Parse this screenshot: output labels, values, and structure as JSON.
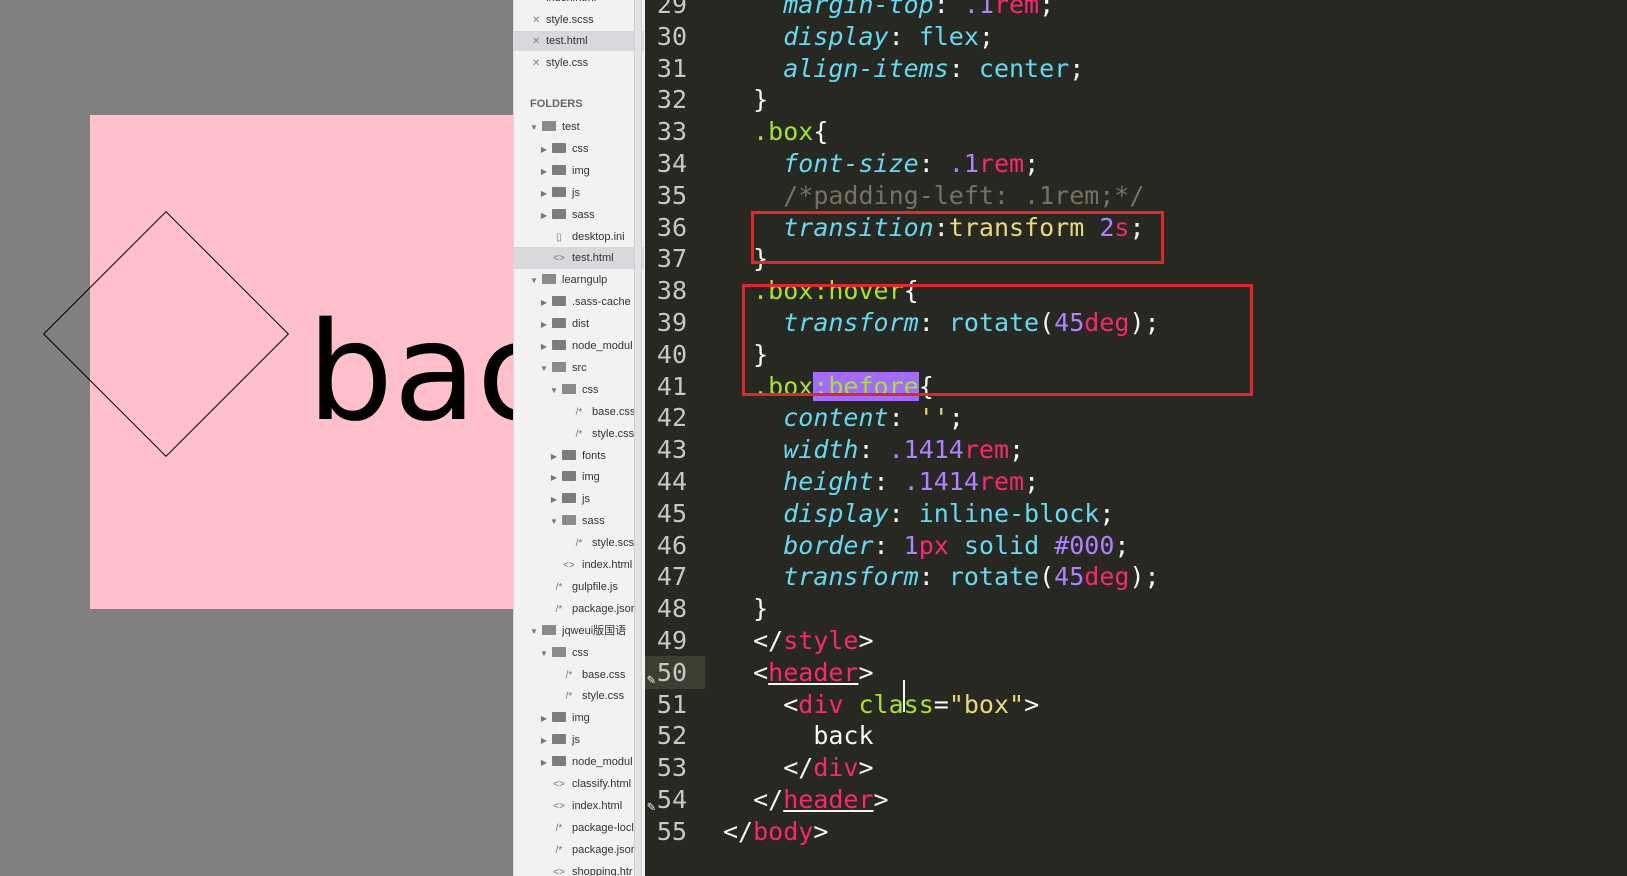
{
  "preview": {
    "text": "bac"
  },
  "open_files": [
    {
      "name": "index.html",
      "active": false
    },
    {
      "name": "style.scss",
      "active": false
    },
    {
      "name": "test.html",
      "active": true
    },
    {
      "name": "style.css",
      "active": false
    }
  ],
  "sidebar": {
    "folders_title": "FOLDERS",
    "tree": [
      {
        "label": "test",
        "depth": 0,
        "type": "folder",
        "open": true
      },
      {
        "label": "css",
        "depth": 1,
        "type": "folder",
        "open": false
      },
      {
        "label": "img",
        "depth": 1,
        "type": "folder",
        "open": false
      },
      {
        "label": "js",
        "depth": 1,
        "type": "folder",
        "open": false
      },
      {
        "label": "sass",
        "depth": 1,
        "type": "folder",
        "open": false
      },
      {
        "label": "desktop.ini",
        "depth": 1,
        "type": "file",
        "icon": "file-icon"
      },
      {
        "label": "test.html",
        "depth": 1,
        "type": "file",
        "icon": "html-icon",
        "active": true
      },
      {
        "label": "learngulp",
        "depth": 0,
        "type": "folder",
        "open": true
      },
      {
        "label": ".sass-cache",
        "depth": 1,
        "type": "folder",
        "open": false
      },
      {
        "label": "dist",
        "depth": 1,
        "type": "folder",
        "open": false
      },
      {
        "label": "node_modul",
        "depth": 1,
        "type": "folder",
        "open": false
      },
      {
        "label": "src",
        "depth": 1,
        "type": "folder",
        "open": true
      },
      {
        "label": "css",
        "depth": 2,
        "type": "folder",
        "open": true
      },
      {
        "label": "base.css",
        "depth": 3,
        "type": "file",
        "icon": "comment-file-icon"
      },
      {
        "label": "style.css",
        "depth": 3,
        "type": "file",
        "icon": "comment-file-icon"
      },
      {
        "label": "fonts",
        "depth": 2,
        "type": "folder",
        "open": false
      },
      {
        "label": "img",
        "depth": 2,
        "type": "folder",
        "open": false
      },
      {
        "label": "js",
        "depth": 2,
        "type": "folder",
        "open": false
      },
      {
        "label": "sass",
        "depth": 2,
        "type": "folder",
        "open": true
      },
      {
        "label": "style.scss",
        "depth": 3,
        "type": "file",
        "icon": "comment-file-icon"
      },
      {
        "label": "index.html",
        "depth": 2,
        "type": "file",
        "icon": "html-icon"
      },
      {
        "label": "gulpfile.js",
        "depth": 1,
        "type": "file",
        "icon": "comment-file-icon"
      },
      {
        "label": "package.jsor",
        "depth": 1,
        "type": "file",
        "icon": "comment-file-icon"
      },
      {
        "label": "jqweui版国语",
        "depth": 0,
        "type": "folder",
        "open": true
      },
      {
        "label": "css",
        "depth": 1,
        "type": "folder",
        "open": true
      },
      {
        "label": "base.css",
        "depth": 2,
        "type": "file",
        "icon": "comment-file-icon"
      },
      {
        "label": "style.css",
        "depth": 2,
        "type": "file",
        "icon": "comment-file-icon"
      },
      {
        "label": "img",
        "depth": 1,
        "type": "folder",
        "open": false
      },
      {
        "label": "js",
        "depth": 1,
        "type": "folder",
        "open": false
      },
      {
        "label": "node_modul",
        "depth": 1,
        "type": "folder",
        "open": false
      },
      {
        "label": "classify.html",
        "depth": 1,
        "type": "file",
        "icon": "html-icon"
      },
      {
        "label": "index.html",
        "depth": 1,
        "type": "file",
        "icon": "html-icon"
      },
      {
        "label": "package-locl",
        "depth": 1,
        "type": "file",
        "icon": "comment-file-icon"
      },
      {
        "label": "package.jsor",
        "depth": 1,
        "type": "file",
        "icon": "comment-file-icon"
      },
      {
        "label": "shopping.htr",
        "depth": 1,
        "type": "file",
        "icon": "html-icon"
      }
    ]
  },
  "editor": {
    "current_line": 50,
    "lines": [
      {
        "n": "29",
        "marker": false,
        "tokens": [
          [
            "  ",
            "t"
          ],
          [
            "margin-top",
            "prop"
          ],
          [
            ": ",
            "t"
          ],
          [
            ".1",
            "num"
          ],
          [
            "rem",
            "unit"
          ],
          [
            ";",
            "t"
          ]
        ]
      },
      {
        "n": "30",
        "marker": false,
        "tokens": [
          [
            "  ",
            "t"
          ],
          [
            "display",
            "prop"
          ],
          [
            ": ",
            "t"
          ],
          [
            "flex",
            "val"
          ],
          [
            ";",
            "t"
          ]
        ]
      },
      {
        "n": "31",
        "marker": false,
        "tokens": [
          [
            "  ",
            "t"
          ],
          [
            "align-items",
            "prop"
          ],
          [
            ": ",
            "t"
          ],
          [
            "center",
            "val"
          ],
          [
            ";",
            "t"
          ]
        ]
      },
      {
        "n": "32",
        "marker": false,
        "tokens": [
          [
            "}",
            "t"
          ]
        ]
      },
      {
        "n": "33",
        "marker": false,
        "tokens": [
          [
            ".box",
            "sel"
          ],
          [
            "{",
            "t"
          ]
        ]
      },
      {
        "n": "34",
        "marker": false,
        "tokens": [
          [
            "  ",
            "t"
          ],
          [
            "font-size",
            "prop"
          ],
          [
            ": ",
            "t"
          ],
          [
            ".1",
            "num"
          ],
          [
            "rem",
            "unit"
          ],
          [
            ";",
            "t"
          ]
        ]
      },
      {
        "n": "35",
        "marker": false,
        "tokens": [
          [
            "  ",
            "t"
          ],
          [
            "/*padding-left: .1rem;*/",
            "cmt"
          ]
        ]
      },
      {
        "n": "36",
        "marker": false,
        "tokens": [
          [
            "  ",
            "t"
          ],
          [
            "transition",
            "prop"
          ],
          [
            ":",
            "t"
          ],
          [
            "transform ",
            "tval"
          ],
          [
            "2",
            "num"
          ],
          [
            "s",
            "unit"
          ],
          [
            ";",
            "t"
          ]
        ]
      },
      {
        "n": "37",
        "marker": false,
        "tokens": [
          [
            "}",
            "t"
          ]
        ]
      },
      {
        "n": "38",
        "marker": false,
        "tokens": [
          [
            ".box:hover",
            "sel"
          ],
          [
            "{",
            "t"
          ]
        ]
      },
      {
        "n": "39",
        "marker": false,
        "tokens": [
          [
            "  ",
            "t"
          ],
          [
            "transform",
            "prop"
          ],
          [
            ": ",
            "t"
          ],
          [
            "rotate",
            "fn"
          ],
          [
            "(",
            "t"
          ],
          [
            "45",
            "num"
          ],
          [
            "deg",
            "unit"
          ],
          [
            ");",
            "t"
          ]
        ]
      },
      {
        "n": "40",
        "marker": false,
        "tokens": [
          [
            "}",
            "t"
          ]
        ]
      },
      {
        "n": "41",
        "marker": false,
        "tokens": [
          [
            ".box",
            "sel"
          ],
          [
            ":before",
            "hl"
          ],
          [
            "{",
            "t"
          ]
        ]
      },
      {
        "n": "42",
        "marker": false,
        "tokens": [
          [
            "  ",
            "t"
          ],
          [
            "content",
            "prop"
          ],
          [
            ": ",
            "t"
          ],
          [
            "''",
            "str"
          ],
          [
            ";",
            "t"
          ]
        ]
      },
      {
        "n": "43",
        "marker": false,
        "tokens": [
          [
            "  ",
            "t"
          ],
          [
            "width",
            "prop"
          ],
          [
            ": ",
            "t"
          ],
          [
            ".1414",
            "num"
          ],
          [
            "rem",
            "unit"
          ],
          [
            ";",
            "t"
          ]
        ]
      },
      {
        "n": "44",
        "marker": false,
        "tokens": [
          [
            "  ",
            "t"
          ],
          [
            "height",
            "prop"
          ],
          [
            ": ",
            "t"
          ],
          [
            ".1414",
            "num"
          ],
          [
            "rem",
            "unit"
          ],
          [
            ";",
            "t"
          ]
        ]
      },
      {
        "n": "45",
        "marker": false,
        "tokens": [
          [
            "  ",
            "t"
          ],
          [
            "display",
            "prop"
          ],
          [
            ": ",
            "t"
          ],
          [
            "inline-block",
            "val"
          ],
          [
            ";",
            "t"
          ]
        ]
      },
      {
        "n": "46",
        "marker": false,
        "tokens": [
          [
            "  ",
            "t"
          ],
          [
            "border",
            "prop"
          ],
          [
            ": ",
            "t"
          ],
          [
            "1",
            "num"
          ],
          [
            "px",
            "unit"
          ],
          [
            " ",
            "t"
          ],
          [
            "solid",
            "val"
          ],
          [
            " ",
            "t"
          ],
          [
            "#000",
            "num"
          ],
          [
            ";",
            "t"
          ]
        ]
      },
      {
        "n": "47",
        "marker": false,
        "tokens": [
          [
            "  ",
            "t"
          ],
          [
            "transform",
            "prop"
          ],
          [
            ": ",
            "t"
          ],
          [
            "rotate",
            "fn"
          ],
          [
            "(",
            "t"
          ],
          [
            "45",
            "num"
          ],
          [
            "deg",
            "unit"
          ],
          [
            ");",
            "t"
          ]
        ]
      },
      {
        "n": "48",
        "marker": false,
        "tokens": [
          [
            "}",
            "t"
          ]
        ]
      },
      {
        "n": "49",
        "marker": false,
        "tokens": [
          [
            "</",
            "t"
          ],
          [
            "style",
            "tagp"
          ],
          [
            ">",
            "t"
          ]
        ]
      },
      {
        "n": "50",
        "marker": true,
        "tokens": [
          [
            "<",
            "t"
          ],
          [
            "header",
            "tag"
          ],
          [
            ">",
            "t"
          ]
        ]
      },
      {
        "n": "51",
        "marker": false,
        "tokens": [
          [
            "  <",
            "t"
          ],
          [
            "div",
            "tagp"
          ],
          [
            " ",
            "t"
          ],
          [
            "class",
            "attr"
          ],
          [
            "=",
            "t"
          ],
          [
            "\"box\"",
            "str"
          ],
          [
            ">",
            "t"
          ]
        ]
      },
      {
        "n": "52",
        "marker": false,
        "tokens": [
          [
            "    back",
            "t"
          ]
        ]
      },
      {
        "n": "53",
        "marker": false,
        "tokens": [
          [
            "  </",
            "t"
          ],
          [
            "div",
            "tagp"
          ],
          [
            ">",
            "t"
          ]
        ]
      },
      {
        "n": "54",
        "marker": true,
        "tokens": [
          [
            "</",
            "t"
          ],
          [
            "header",
            "tag"
          ],
          [
            ">",
            "t"
          ]
        ]
      },
      {
        "n": "55",
        "marker": false,
        "tokens": [
          [
            "</",
            "t"
          ],
          [
            "body",
            "tagp"
          ],
          [
            ">",
            "t"
          ]
        ]
      }
    ]
  }
}
